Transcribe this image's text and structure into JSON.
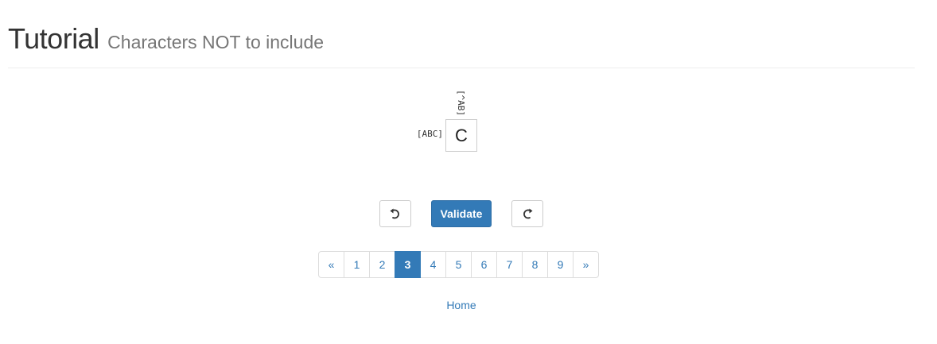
{
  "header": {
    "title": "Tutorial",
    "subtitle": "Characters NOT to include"
  },
  "puzzle": {
    "column_clue": "[^AB]",
    "row_clue": "[ABC]",
    "cell_value": "C"
  },
  "controls": {
    "undo_icon": "undo-arrow-icon",
    "validate_label": "Validate",
    "redo_icon": "redo-arrow-icon"
  },
  "pagination": {
    "prev_label": "«",
    "pages": [
      "1",
      "2",
      "3",
      "4",
      "5",
      "6",
      "7",
      "8",
      "9"
    ],
    "active_page": "3",
    "next_label": "»"
  },
  "footer": {
    "home_label": "Home"
  },
  "colors": {
    "accent": "#337ab7",
    "border": "#cccccc"
  }
}
